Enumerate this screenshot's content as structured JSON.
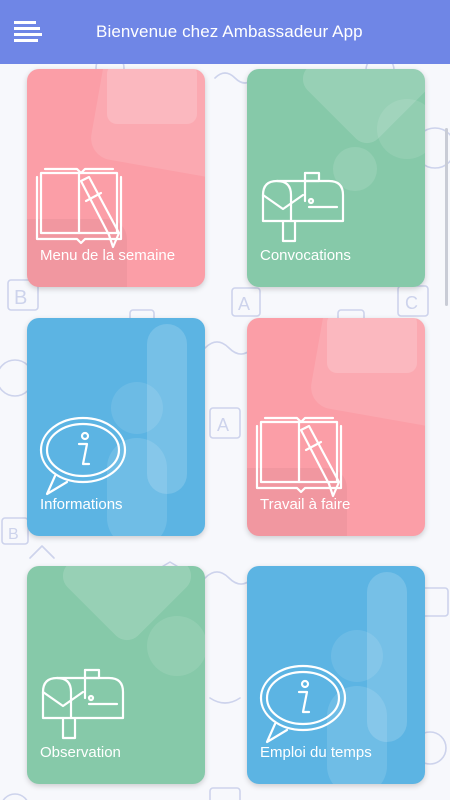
{
  "app_bar": {
    "menu_icon": "hamburger-menu-icon",
    "title": "Bienvenue chez Ambassadeur App",
    "color": "#6f86e6"
  },
  "tiles": [
    {
      "label": "Menu de la semaine",
      "color": "#fb9ea7",
      "icon": "book-pencil-icon"
    },
    {
      "label": "Convocations",
      "color": "#86c9a9",
      "icon": "mailbox-icon"
    },
    {
      "label": "Informations",
      "color": "#5cb4e3",
      "icon": "info-bubble-icon"
    },
    {
      "label": "Travail à faire",
      "color": "#fb9ea7",
      "icon": "book-pencil-icon"
    },
    {
      "label": "Observation",
      "color": "#86c9a9",
      "icon": "mailbox-icon"
    },
    {
      "label": "Emploi du temps",
      "color": "#5cb4e3",
      "icon": "info-bubble-icon"
    }
  ]
}
